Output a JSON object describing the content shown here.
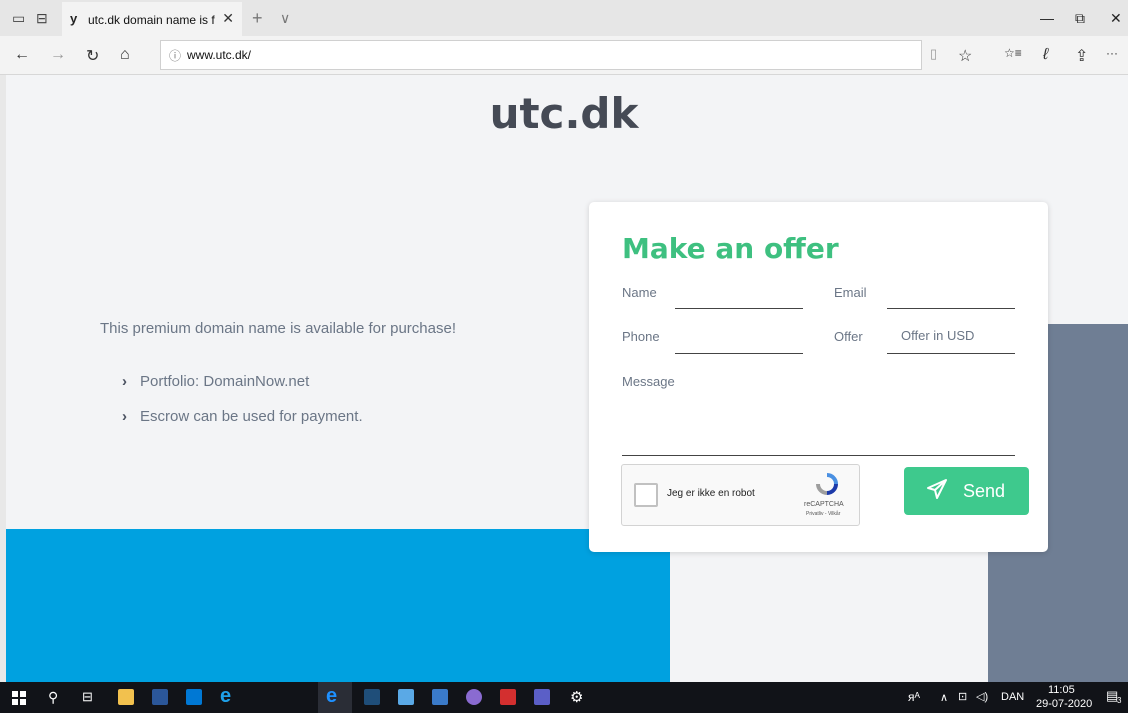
{
  "browser": {
    "tab_favicon": "y",
    "tab_title": "utc.dk domain name is f",
    "tab_close": "✕",
    "new_tab": "+",
    "tab_menu": "∨",
    "url": "www.utc.dk/",
    "info_icon": "ⓘ",
    "minimize": "—",
    "restore": "⧉",
    "close": "✕",
    "back": "←",
    "forward": "→",
    "refresh": "↻",
    "home": "⌂",
    "reading_view": "▯",
    "favorite": "☆",
    "favorites_hub": "☆≡",
    "notes": "ℓ",
    "share": "⇪",
    "more": "···"
  },
  "page": {
    "brand": "utc.dk",
    "lead": "This premium domain name is available for purchase!",
    "bullets": [
      "Portfolio: DomainNow.net",
      "Escrow can be used for payment."
    ],
    "bullet_chevron": "›"
  },
  "form": {
    "title": "Make an offer",
    "name_label": "Name",
    "email_label": "Email",
    "phone_label": "Phone",
    "offer_label": "Offer",
    "offer_placeholder": "Offer in USD",
    "message_label": "Message",
    "captcha_text": "Jeg er ikke en robot",
    "captcha_brand": "reCAPTCHA",
    "captcha_links": "Privatliv - Vilkår",
    "send_label": "Send",
    "send_icon": "send-icon"
  },
  "taskbar": {
    "lang": "DAN",
    "time": "11:05",
    "date": "29-07-2020",
    "notif_count": "3"
  },
  "colors": {
    "accent_green": "#3ec080",
    "blue_block": "#00a1e0",
    "slate_block": "#6f7e94"
  }
}
